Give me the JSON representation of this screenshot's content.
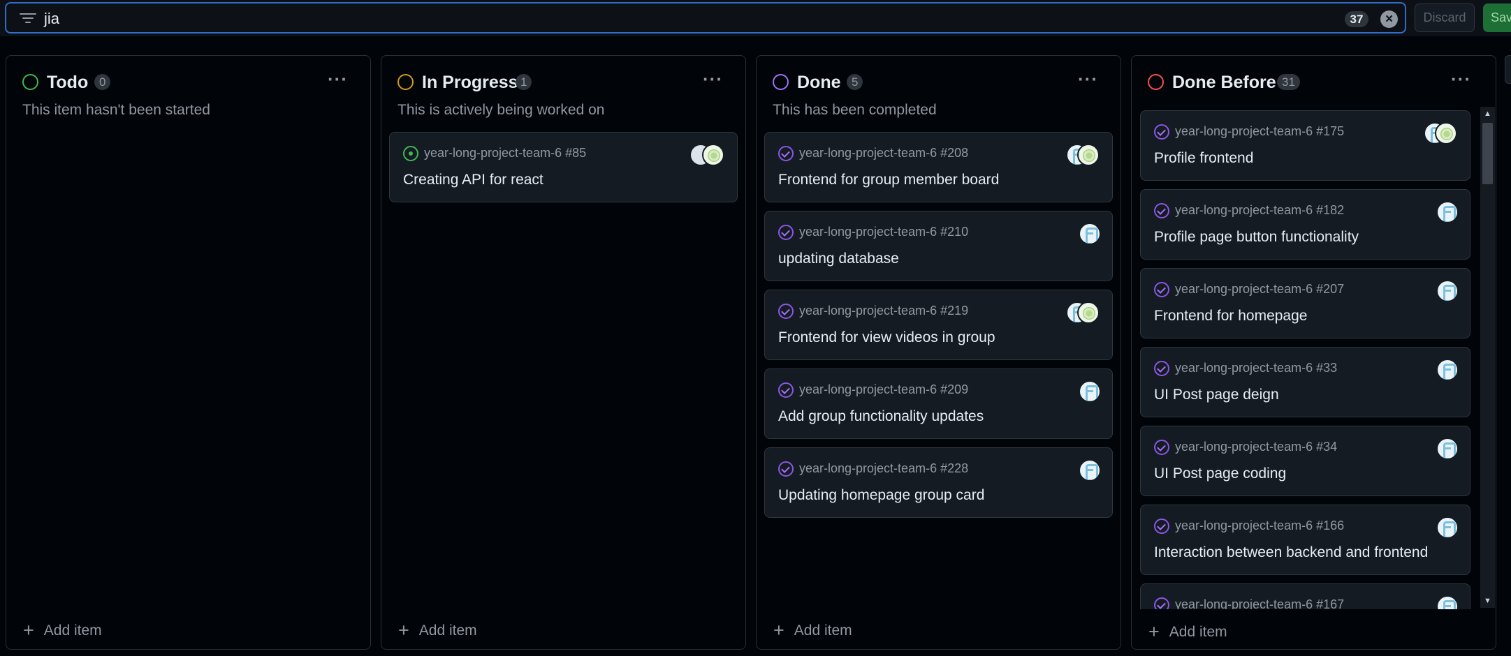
{
  "filter": {
    "query": "jia",
    "result_count": "37",
    "clear_icon": "x-circle-icon",
    "discard_label": "Discard",
    "save_label": "Save"
  },
  "colors": {
    "todo": "#3fb950",
    "in_progress": "#d29922",
    "done": "#a371f7",
    "done_before": "#f85149"
  },
  "columns": [
    {
      "title": "Todo",
      "count": "0",
      "description": "This item hasn't been started",
      "add_label": "Add item",
      "cards": []
    },
    {
      "title": "In Progress",
      "count": "1",
      "description": "This is actively being worked on",
      "add_label": "Add item",
      "cards": [
        {
          "repo": "year-long-project-team-6 #85",
          "title": "Creating API for react",
          "state": "open"
        }
      ]
    },
    {
      "title": "Done",
      "count": "5",
      "description": "This has been completed",
      "add_label": "Add item",
      "cards": [
        {
          "repo": "year-long-project-team-6 #208",
          "title": "Frontend for group member board",
          "state": "done"
        },
        {
          "repo": "year-long-project-team-6 #210",
          "title": "updating database",
          "state": "done"
        },
        {
          "repo": "year-long-project-team-6 #219",
          "title": "Frontend for view videos in group",
          "state": "done"
        },
        {
          "repo": "year-long-project-team-6 #209",
          "title": "Add group functionality updates",
          "state": "done"
        },
        {
          "repo": "year-long-project-team-6 #228",
          "title": "Updating homepage group card",
          "state": "done"
        }
      ]
    },
    {
      "title": "Done Before",
      "count": "31",
      "description": "",
      "add_label": "Add item",
      "cards": [
        {
          "repo": "year-long-project-team-6 #175",
          "title": "Profile frontend",
          "state": "done"
        },
        {
          "repo": "year-long-project-team-6 #182",
          "title": "Profile page button functionality",
          "state": "done"
        },
        {
          "repo": "year-long-project-team-6 #207",
          "title": "Frontend for homepage",
          "state": "done"
        },
        {
          "repo": "year-long-project-team-6 #33",
          "title": "UI Post page deign",
          "state": "done"
        },
        {
          "repo": "year-long-project-team-6 #34",
          "title": "UI Post page coding",
          "state": "done"
        },
        {
          "repo": "year-long-project-team-6 #166",
          "title": "Interaction between backend and frontend",
          "state": "done"
        },
        {
          "repo": "year-long-project-team-6 #167",
          "title": "",
          "state": "done"
        }
      ]
    }
  ]
}
